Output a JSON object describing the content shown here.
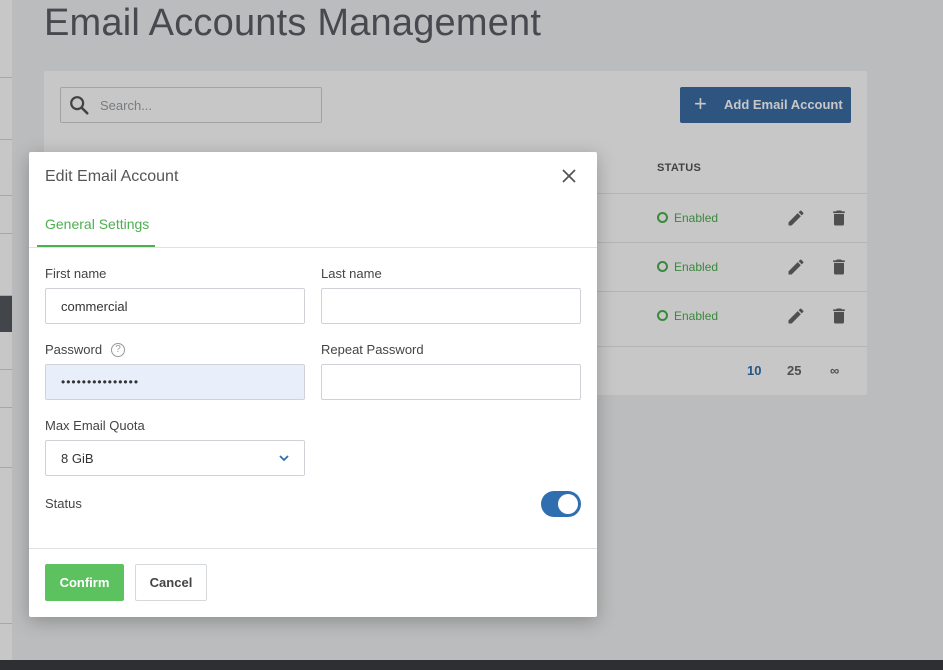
{
  "page": {
    "title": "Email Accounts Management"
  },
  "toolbar": {
    "search_placeholder": "Search...",
    "add_label": "Add Email Account",
    "add_icon": "plus-icon"
  },
  "table": {
    "status_header": "STATUS",
    "rows": [
      {
        "status": "Enabled"
      },
      {
        "status": "Enabled"
      },
      {
        "status": "Enabled"
      }
    ],
    "status_color": "#4caf50"
  },
  "pagination": {
    "options": [
      "10",
      "25",
      "∞"
    ],
    "selected": "10"
  },
  "modal": {
    "title": "Edit Email Account",
    "tab": "General Settings",
    "first_name_label": "First name",
    "first_name_value": "commercial",
    "last_name_label": "Last name",
    "last_name_value": "",
    "password_label": "Password",
    "password_value": "•••••••••••••••",
    "repeat_password_label": "Repeat Password",
    "repeat_password_value": "",
    "quota_label": "Max Email Quota",
    "quota_value": "8 GiB",
    "status_label": "Status",
    "status_on": true,
    "confirm_label": "Confirm",
    "cancel_label": "Cancel"
  },
  "colors": {
    "accent_green": "#5cc25f",
    "primary_blue": "#3a6ea5",
    "toggle_blue": "#2f6fb0"
  }
}
